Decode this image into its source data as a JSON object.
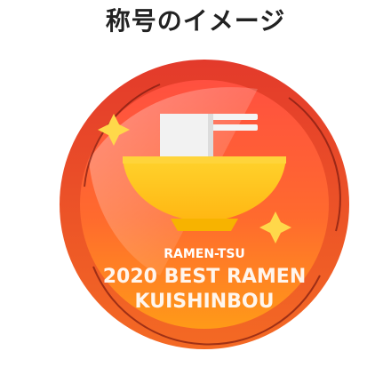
{
  "header": {
    "title": "称号のイメージ"
  },
  "badge": {
    "line1": "RAMEN-TSU",
    "line2": "2020 BEST RAMEN",
    "line3": "KUISHINBOU",
    "colors": {
      "rim_outer": "#e7452e",
      "rim_inner": "#f05a2a",
      "face_top": "#ff5a3c",
      "face_bottom": "#ff8f1c",
      "bowl": "#ffc21a",
      "bowl_shadow": "#f0a900",
      "noodle_block": "#f2f2f2",
      "sparkle": "#ffd84a"
    }
  }
}
